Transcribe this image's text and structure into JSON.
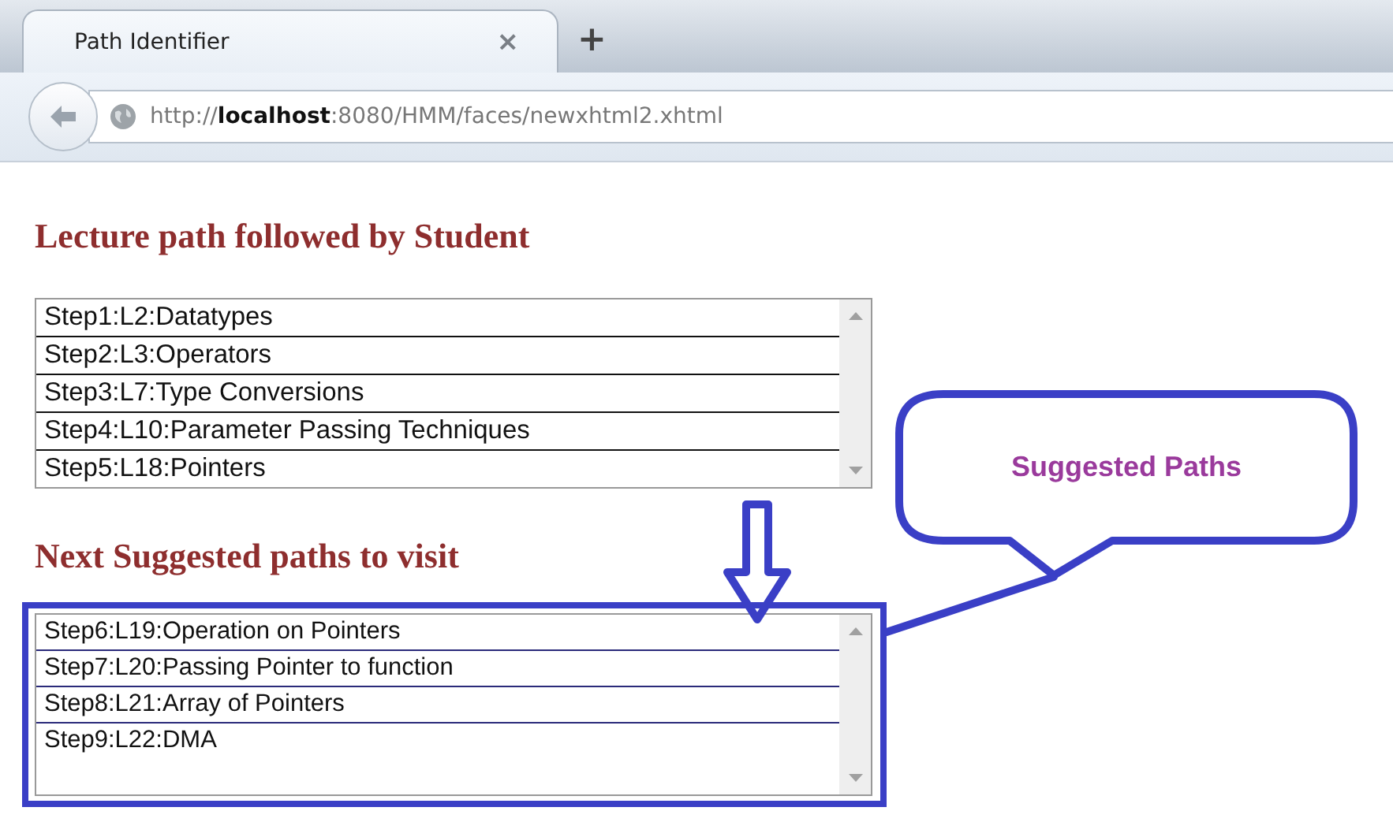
{
  "tab": {
    "title": "Path Identifier",
    "close": "×",
    "selected": true
  },
  "new_tab": "+",
  "address": "http://**localhost**:8080/HMM/faces/newxhtml2.xhtml",
  "followed": {
    "heading": "Lecture path followed by Student",
    "items": [
      {
        "label": "Step1:L2:Datatypes"
      },
      {
        "label": "Step2:L3:Operators"
      },
      {
        "label": "Step3:L7:Type Conversions"
      },
      {
        "label": "Step4:L10:Parameter Passing Techniques"
      },
      {
        "label": "Step5:L18:Pointers"
      }
    ]
  },
  "suggested": {
    "heading": "Next Suggested paths to visit",
    "items": [
      {
        "label": "Step6:L19:Operation on Pointers"
      },
      {
        "label": "Step7:L20:Passing Pointer to function"
      },
      {
        "label": "Step8:L21:Array of Pointers"
      },
      {
        "label": "Step9:L22:DMA"
      }
    ]
  },
  "callout": "Suggested Paths"
}
